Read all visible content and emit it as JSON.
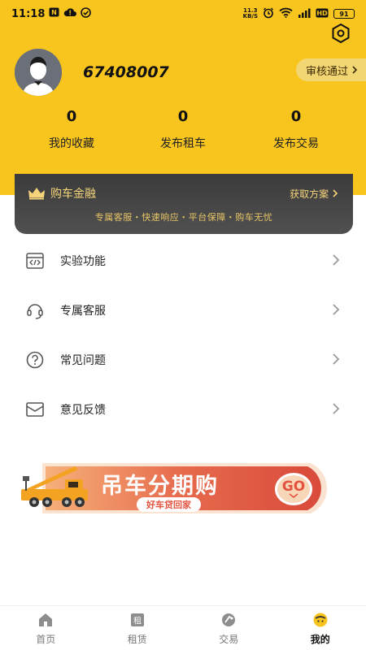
{
  "status_bar": {
    "time": "11:18",
    "net_speed_value": "11.3",
    "net_speed_unit": "KB/S",
    "battery": "91"
  },
  "profile": {
    "user_id": "67408007",
    "audit_badge": "审核通过"
  },
  "stats": [
    {
      "value": "0",
      "label": "我的收藏"
    },
    {
      "value": "0",
      "label": "发布租车"
    },
    {
      "value": "0",
      "label": "发布交易"
    }
  ],
  "finance": {
    "title": "购车金融",
    "link": "获取方案",
    "subtitle": "专属客服・快速响应・平台保障・购车无忧"
  },
  "menu": [
    {
      "label": "实验功能",
      "icon": "code-window-icon"
    },
    {
      "label": "专属客服",
      "icon": "headset-icon"
    },
    {
      "label": "常见问题",
      "icon": "question-icon"
    },
    {
      "label": "意见反馈",
      "icon": "mail-icon"
    }
  ],
  "banner": {
    "headline": "吊车分期购",
    "tagline": "好车贷回家",
    "cta": "GO"
  },
  "tabs": [
    {
      "label": "首页",
      "icon": "home-icon",
      "active": false
    },
    {
      "label": "租赁",
      "icon": "rent-icon",
      "active": false
    },
    {
      "label": "交易",
      "icon": "trade-icon",
      "active": false
    },
    {
      "label": "我的",
      "icon": "profile-icon",
      "active": true
    }
  ],
  "colors": {
    "brand_yellow": "#F8C41E",
    "finance_gold": "#F6D47A",
    "banner_red": "#E4523F"
  }
}
